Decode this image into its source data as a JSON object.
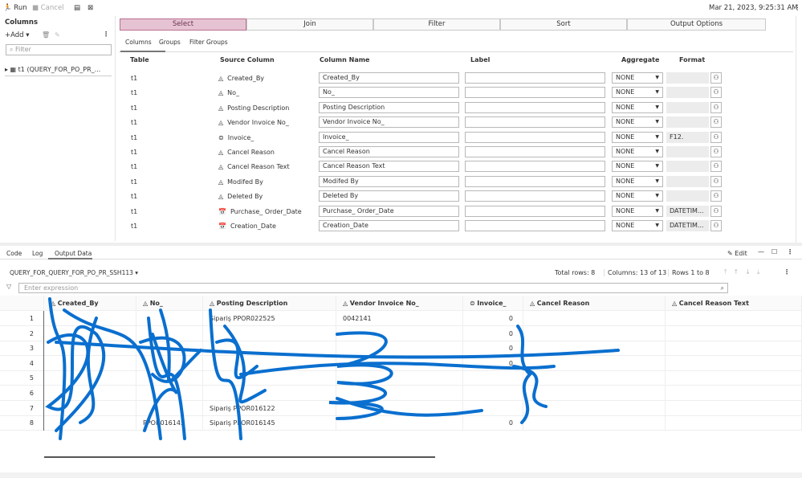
{
  "toolbar": {
    "run": "Run",
    "cancel": "Cancel",
    "timestamp": "Mar 21, 2023, 9:25:31 AM"
  },
  "left": {
    "title": "Columns",
    "add": "Add",
    "filter_placeholder": "Filter",
    "tree_item": "t1 (QUERY_FOR_PO_PR_..."
  },
  "tabs": [
    "Select",
    "Join",
    "Filter",
    "Sort",
    "Output Options"
  ],
  "subtabs": [
    "Columns",
    "Groups",
    "Filter Groups"
  ],
  "headers": {
    "table": "Table",
    "source": "Source Column",
    "name": "Column Name",
    "label": "Label",
    "aggregate": "Aggregate",
    "format": "Format"
  },
  "columns": [
    {
      "table": "t1",
      "source": "Created_By",
      "type": "char",
      "name": "Created_By",
      "agg": "NONE",
      "format": ""
    },
    {
      "table": "t1",
      "source": "No_",
      "type": "char",
      "name": "No_",
      "agg": "NONE",
      "format": ""
    },
    {
      "table": "t1",
      "source": "Posting Description",
      "type": "char",
      "name": "Posting Description",
      "agg": "NONE",
      "format": ""
    },
    {
      "table": "t1",
      "source": "Vendor Invoice No_",
      "type": "char",
      "name": "Vendor Invoice No_",
      "agg": "NONE",
      "format": ""
    },
    {
      "table": "t1",
      "source": "Invoice_",
      "type": "num",
      "name": "Invoice_",
      "agg": "NONE",
      "format": "F12."
    },
    {
      "table": "t1",
      "source": "Cancel Reason",
      "type": "char",
      "name": "Cancel Reason",
      "agg": "NONE",
      "format": ""
    },
    {
      "table": "t1",
      "source": "Cancel Reason Text",
      "type": "char",
      "name": "Cancel Reason Text",
      "agg": "NONE",
      "format": ""
    },
    {
      "table": "t1",
      "source": "Modifed By",
      "type": "char",
      "name": "Modifed By",
      "agg": "NONE",
      "format": ""
    },
    {
      "table": "t1",
      "source": "Deleted By",
      "type": "char",
      "name": "Deleted By",
      "agg": "NONE",
      "format": ""
    },
    {
      "table": "t1",
      "source": "Purchase_ Order_Date",
      "type": "date",
      "name": "Purchase_ Order_Date",
      "agg": "NONE",
      "format": "DATETIM..."
    },
    {
      "table": "t1",
      "source": "Creation_Date",
      "type": "date",
      "name": "Creation_Date",
      "agg": "NONE",
      "format": "DATETIM..."
    }
  ],
  "bottom": {
    "tabs": [
      "Code",
      "Log",
      "Output Data"
    ],
    "edit": "Edit",
    "dataset": "QUERY_FOR_QUERY_FOR_PO_PR_SSH113",
    "total_rows": "Total rows: 8",
    "columns_count": "Columns: 13 of 13",
    "rows_range": "Rows 1 to 8",
    "expr_placeholder": "Enter expression",
    "grid_headers": [
      "Created_By",
      "No_",
      "Posting Description",
      "Vendor Invoice No_",
      "Invoice_",
      "Cancel Reason",
      "Cancel Reason Text"
    ],
    "rows": [
      [
        "1",
        "",
        "",
        "Sipariş PPOR022525",
        "0042141",
        "0",
        "",
        ""
      ],
      [
        "2",
        "",
        "",
        "",
        "",
        "0",
        "",
        ""
      ],
      [
        "3",
        "",
        "",
        "",
        "",
        "0",
        "",
        ""
      ],
      [
        "4",
        "",
        "",
        "",
        "",
        "0",
        "",
        ""
      ],
      [
        "5",
        "",
        "",
        "",
        "",
        "",
        "",
        ""
      ],
      [
        "6",
        "",
        "",
        "",
        "",
        "",
        "",
        ""
      ],
      [
        "7",
        "",
        "",
        "Sipariş PPOR016122",
        "",
        "",
        "",
        ""
      ],
      [
        "8",
        "",
        "PPOR016145",
        "Sipariş PPOR016145",
        "",
        "0",
        "",
        ""
      ]
    ]
  },
  "colors": {
    "accent": "#e6c3d3",
    "scribble": "#0a6fcf"
  }
}
